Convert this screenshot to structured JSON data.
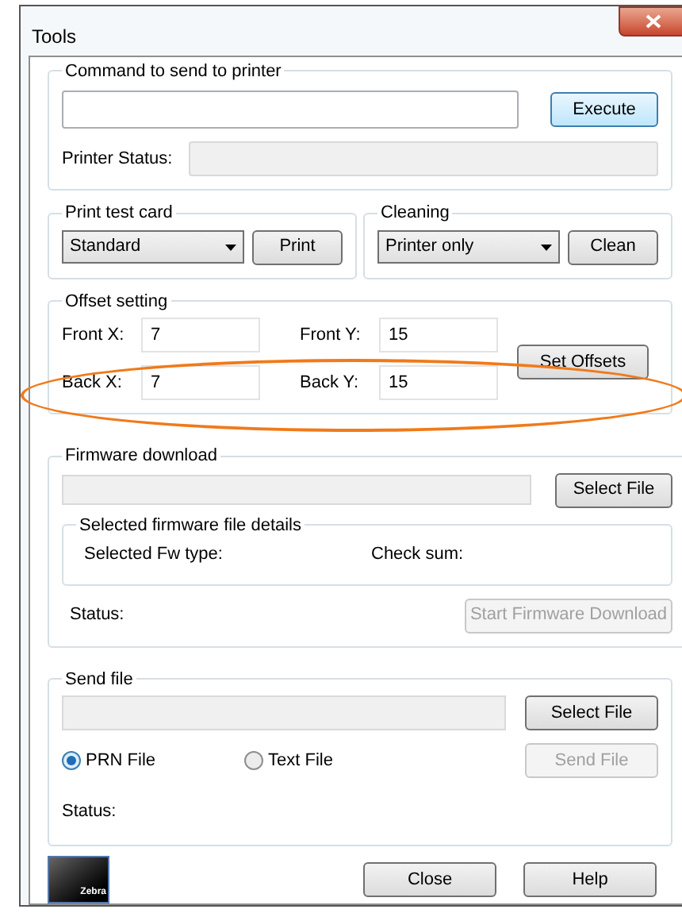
{
  "window": {
    "title": "Tools"
  },
  "command": {
    "label": "Command to send to printer",
    "button": {
      "label": "Execute",
      "focused": true
    },
    "status_label": "Printer Status:"
  },
  "print_test": {
    "label": "Print test card",
    "select": "Standard",
    "button": "Print"
  },
  "cleaning": {
    "label": "Cleaning",
    "select": "Printer only",
    "button": "Clean"
  },
  "offsets": {
    "label": "Offset setting",
    "highlighted": true,
    "button": "Set Offsets",
    "fields": [
      {
        "label": "Front X:",
        "value": "7"
      },
      {
        "label": "Front Y:",
        "value": "15"
      },
      {
        "label": "Back X:",
        "value": "7"
      },
      {
        "label": "Back Y:",
        "value": "15"
      }
    ]
  },
  "firmware": {
    "label": "Firmware download",
    "button": "Select File",
    "details": {
      "label": "Selected firmware file details",
      "items": [
        "Selected Fw type:",
        "Check sum:"
      ]
    },
    "status_label": "Status:",
    "start_button": {
      "label": "Start Firmware Download",
      "disabled": true
    }
  },
  "send_file": {
    "label": "Send file",
    "button": "Select File",
    "radios": [
      {
        "label": "PRN File",
        "selected": true
      },
      {
        "label": "Text File",
        "selected": false
      }
    ],
    "send_button": {
      "label": "Send File",
      "disabled": true
    },
    "status_label": "Status:"
  },
  "logo": {
    "text": "Zebra"
  },
  "buttons": [
    "Close",
    "Help"
  ]
}
